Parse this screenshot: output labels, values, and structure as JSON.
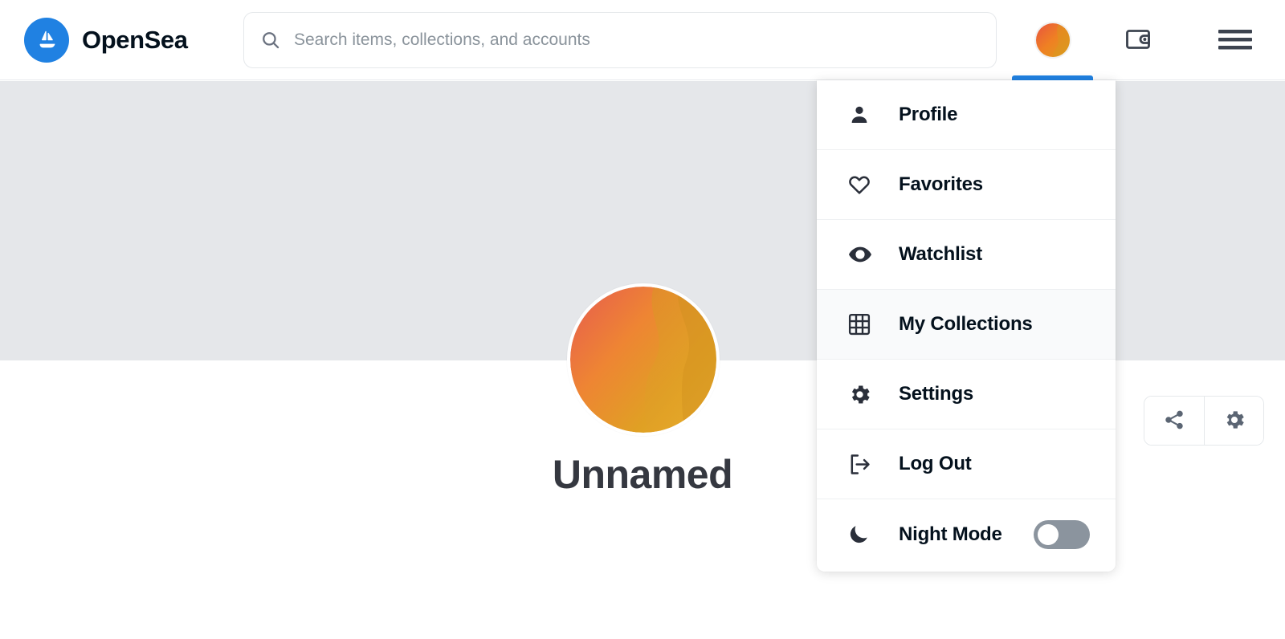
{
  "header": {
    "brand_name": "OpenSea",
    "logo_icon": "opensea-sailboat-logo",
    "search": {
      "placeholder": "Search items, collections, and accounts",
      "value": "",
      "icon": "search-icon"
    },
    "avatar_icon": "user-avatar-gradient",
    "wallet_icon": "wallet-icon",
    "menu_icon": "hamburger-menu-icon",
    "active_indicator_color": "#2081e2"
  },
  "profile": {
    "display_name": "Unnamed",
    "avatar_icon": "profile-avatar-gradient",
    "banner_color": "#e5e7ea",
    "actions": [
      {
        "name": "share",
        "icon": "share-icon"
      },
      {
        "name": "settings",
        "icon": "gear-icon"
      }
    ]
  },
  "dropdown": {
    "items": [
      {
        "label": "Profile",
        "icon": "person-icon",
        "active": false,
        "has_toggle": false
      },
      {
        "label": "Favorites",
        "icon": "heart-icon",
        "active": false,
        "has_toggle": false
      },
      {
        "label": "Watchlist",
        "icon": "eye-icon",
        "active": false,
        "has_toggle": false
      },
      {
        "label": "My Collections",
        "icon": "grid-icon",
        "active": true,
        "has_toggle": false
      },
      {
        "label": "Settings",
        "icon": "gear-icon",
        "active": false,
        "has_toggle": false
      },
      {
        "label": "Log Out",
        "icon": "logout-icon",
        "active": false,
        "has_toggle": false
      },
      {
        "label": "Night Mode",
        "icon": "moon-icon",
        "active": false,
        "has_toggle": true,
        "toggle_state": "off"
      }
    ]
  }
}
